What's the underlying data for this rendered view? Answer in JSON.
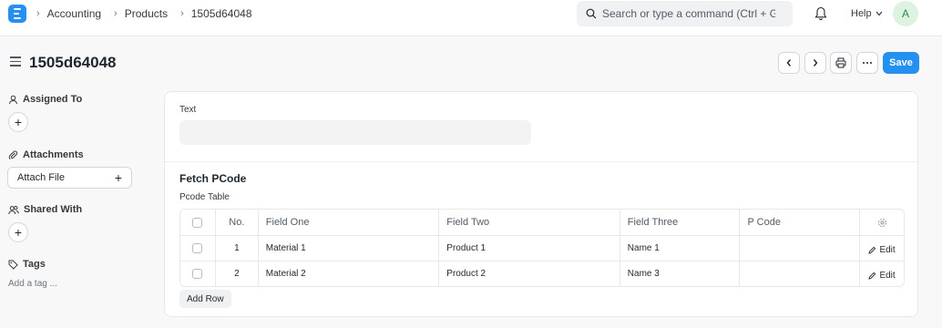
{
  "nav": {
    "breadcrumbs": [
      "Accounting",
      "Products",
      "1505d64048"
    ],
    "search_placeholder": "Search or type a command (Ctrl + G)",
    "help_label": "Help",
    "avatar_initial": "A"
  },
  "page": {
    "title": "1505d64048",
    "save_label": "Save"
  },
  "sidebar": {
    "assigned_to": "Assigned To",
    "attachments": "Attachments",
    "attach_file": "Attach File",
    "shared_with": "Shared With",
    "tags": "Tags",
    "add_tag": "Add a tag ..."
  },
  "form": {
    "text_label": "Text",
    "text_value": "",
    "section_title": "Fetch PCode",
    "table_label": "Pcode Table",
    "columns": [
      "No.",
      "Field One",
      "Field Two",
      "Field Three",
      "P Code"
    ],
    "rows": [
      {
        "no": "1",
        "field_one": "Material 1",
        "field_two": "Product 1",
        "field_three": "Name 1",
        "p_code": "",
        "edit": "Edit"
      },
      {
        "no": "2",
        "field_one": "Material 2",
        "field_two": "Product 2",
        "field_three": "Name 3",
        "p_code": "",
        "edit": "Edit"
      }
    ],
    "add_row_label": "Add Row"
  },
  "colors": {
    "primary": "#2490ef",
    "avatar_bg": "#dcf3e1",
    "avatar_fg": "#2f8a49"
  }
}
